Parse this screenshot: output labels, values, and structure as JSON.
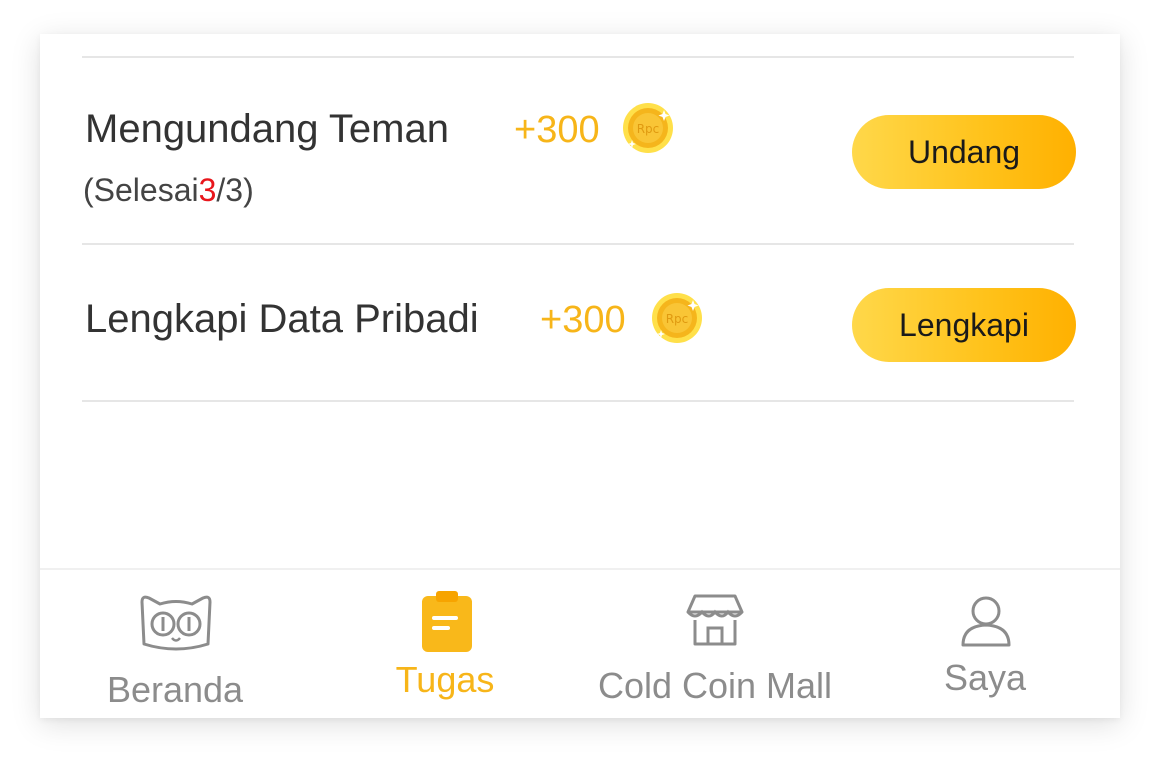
{
  "tasks": [
    {
      "title": "Mengundang Teman",
      "reward": "+300",
      "coin_icon": "rpc-coin-icon",
      "progress_prefix": "(Selesai",
      "progress_done": "3",
      "progress_suffix": "/3)",
      "button_label": "Undang"
    },
    {
      "title": "Lengkapi Data Pribadi",
      "reward": "+300",
      "coin_icon": "rpc-coin-icon",
      "button_label": "Lengkapi"
    }
  ],
  "tabbar": {
    "active": "Tugas",
    "items": [
      {
        "label": "Beranda",
        "icon": "cat-face-icon"
      },
      {
        "label": "Tugas",
        "icon": "clipboard-icon"
      },
      {
        "label": "Cold Coin Mall",
        "icon": "store-icon"
      },
      {
        "label": "Saya",
        "icon": "user-icon"
      }
    ]
  },
  "colors": {
    "accent": "#f7b519",
    "button_gradient_start": "#ffd84a",
    "button_gradient_end": "#ffb000",
    "progress_done": "#e8161c",
    "inactive_tab": "#8c8c8c",
    "text": "#333333"
  }
}
